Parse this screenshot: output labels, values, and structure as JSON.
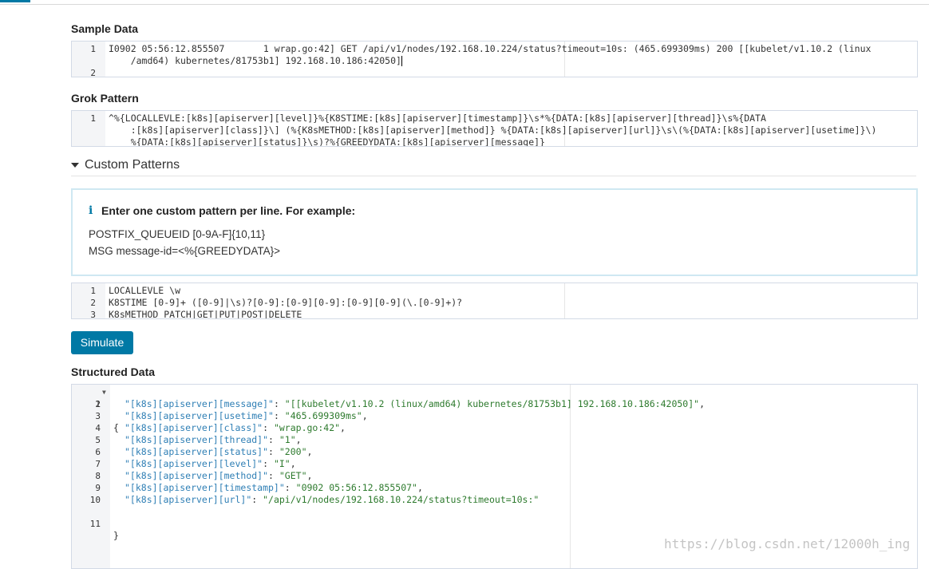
{
  "sample": {
    "title": "Sample Data",
    "lines": [
      {
        "n": "1",
        "text": "I0902 05:56:12.855507       1 wrap.go:42] GET /api/v1/nodes/192.168.10.224/status?timeout=10s: (465.699309ms) 200 [[kubelet/v1.10.2 (linux"
      },
      {
        "n": "",
        "text": "    /amd64) kubernetes/81753b1] 192.168.10.186:42050]"
      },
      {
        "n": "2",
        "text": ""
      }
    ]
  },
  "grok": {
    "title": "Grok Pattern",
    "lines": [
      {
        "n": "1",
        "text": "^%{LOCALLEVLE:[k8s][apiserver][level]}%{K8STIME:[k8s][apiserver][timestamp]}\\s*%{DATA:[k8s][apiserver][thread]}\\s%{DATA"
      },
      {
        "n": "",
        "text": "    :[k8s][apiserver][class]}\\] (%{K8sMETHOD:[k8s][apiserver][method]} %{DATA:[k8s][apiserver][url]}\\s\\(%{DATA:[k8s][apiserver][usetime]}\\)"
      },
      {
        "n": "",
        "text": "    %{DATA:[k8s][apiserver][status]}\\s)?%{GREEDYDATA:[k8s][apiserver][message]}"
      }
    ]
  },
  "custom": {
    "header": "Custom Patterns",
    "callout_title": "Enter one custom pattern per line. For example:",
    "info_icon": "i",
    "example1": "POSTFIX_QUEUEID [0-9A-F]{10,11}",
    "example2": "MSG message-id=<%{GREEDYDATA}>",
    "lines": [
      {
        "n": "1",
        "text": "LOCALLEVLE \\w"
      },
      {
        "n": "2",
        "text": "K8STIME [0-9]+ ([0-9]|\\s)?[0-9]:[0-9][0-9]:[0-9][0-9](\\.[0-9]+)?"
      },
      {
        "n": "3",
        "text": "K8sMETHOD PATCH|GET|PUT|POST|DELETE"
      }
    ]
  },
  "simulate_label": "Simulate",
  "structured": {
    "title": "Structured Data",
    "open_brace": "{",
    "close_brace": "}",
    "entries": [
      {
        "n": "2",
        "key": "\"[k8s][apiserver][message]\"",
        "value": "\"[[kubelet/v1.10.2 (linux/amd64) kubernetes/81753b1] 192.168.10.186:42050]\"",
        "comma": ","
      },
      {
        "n": "3",
        "key": "\"[k8s][apiserver][usetime]\"",
        "value": "\"465.699309ms\"",
        "comma": ","
      },
      {
        "n": "4",
        "key": "\"[k8s][apiserver][class]\"",
        "value": "\"wrap.go:42\"",
        "comma": ","
      },
      {
        "n": "5",
        "key": "\"[k8s][apiserver][thread]\"",
        "value": "\"1\"",
        "comma": ","
      },
      {
        "n": "6",
        "key": "\"[k8s][apiserver][status]\"",
        "value": "\"200\"",
        "comma": ","
      },
      {
        "n": "7",
        "key": "\"[k8s][apiserver][level]\"",
        "value": "\"I\"",
        "comma": ","
      },
      {
        "n": "8",
        "key": "\"[k8s][apiserver][method]\"",
        "value": "\"GET\"",
        "comma": ","
      },
      {
        "n": "9",
        "key": "\"[k8s][apiserver][timestamp]\"",
        "value": "\"0902 05:56:12.855507\"",
        "comma": ","
      },
      {
        "n": "10",
        "key": "\"[k8s][apiserver][url]\"",
        "value": "\"/api/v1/nodes/192.168.10.224/status?timeout=10s:\"",
        "comma": ""
      }
    ],
    "first_n": "1",
    "last_n": "11"
  },
  "watermark": "https://blog.csdn.net/12000h_ing",
  "colors": {
    "accent": "#0079a5",
    "json_key": "#2f7fb5",
    "json_string": "#2d7a2d"
  }
}
